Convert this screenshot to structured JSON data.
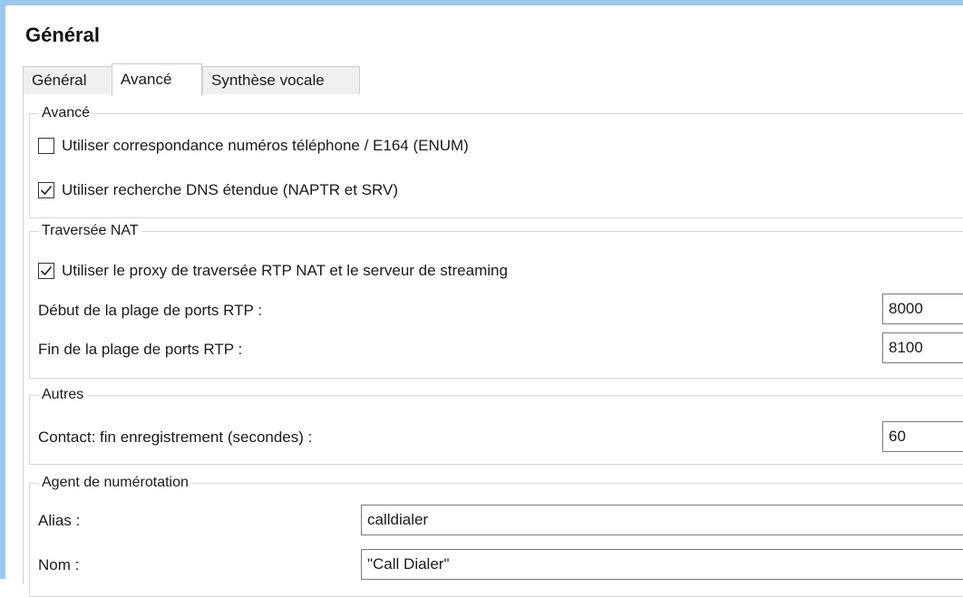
{
  "header": {
    "title": "Général"
  },
  "tabs": [
    {
      "label": "Général"
    },
    {
      "label": "Avancé"
    },
    {
      "label": "Synthèse vocale"
    }
  ],
  "sections": {
    "avance": {
      "title": "Avancé",
      "enum_checkbox": {
        "label": "Utiliser correspondance numéros téléphone / E164 (ENUM)",
        "checked": false
      },
      "dns_checkbox": {
        "label": "Utiliser recherche DNS étendue (NAPTR et SRV)",
        "checked": true
      }
    },
    "nat": {
      "title": "Traversée NAT",
      "proxy_checkbox": {
        "label": "Utiliser le proxy de traversée RTP NAT et le serveur de streaming",
        "checked": true
      },
      "rtp_start_label": "Début de la plage de ports RTP :",
      "rtp_start_value": "8000",
      "rtp_end_label": "Fin de la plage de ports RTP :",
      "rtp_end_value": "8100"
    },
    "autres": {
      "title": "Autres",
      "contact_label": "Contact: fin enregistrement (secondes) :",
      "contact_value": "60"
    },
    "agent": {
      "title": "Agent de numérotation",
      "alias_label": "Alias :",
      "alias_value": "calldialer",
      "nom_label": "Nom :",
      "nom_value": "\"Call Dialer\""
    }
  },
  "icons": {
    "checkmark": "checkmark-icon"
  }
}
